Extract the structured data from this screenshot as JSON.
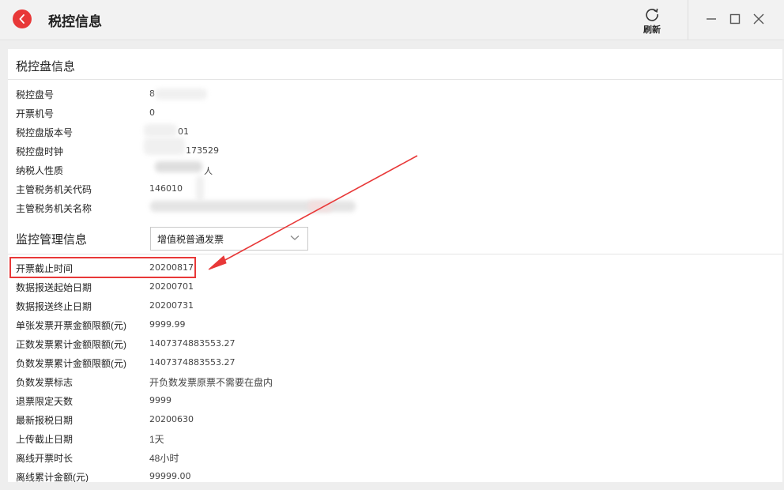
{
  "window": {
    "title": "税控信息",
    "refresh_label": "刷新"
  },
  "section1": {
    "title": "税控盘信息",
    "rows": [
      {
        "label": "税控盘号",
        "value": "8"
      },
      {
        "label": "开票机号",
        "value": "0"
      },
      {
        "label": "税控盘版本号",
        "value": "01"
      },
      {
        "label": "税控盘时钟",
        "value": "173529"
      },
      {
        "label": "纳税人性质",
        "value": "人"
      },
      {
        "label": "主管税务机关代码",
        "value": "146010"
      },
      {
        "label": "主管税务机关名称",
        "value": ""
      }
    ]
  },
  "section2": {
    "title": "监控管理信息",
    "invoice_type_selected": "增值税普通发票",
    "rows": [
      {
        "label": "开票截止时间",
        "value": "20200817"
      },
      {
        "label": "数据报送起始日期",
        "value": "20200701"
      },
      {
        "label": "数据报送终止日期",
        "value": "20200731"
      },
      {
        "label": "单张发票开票金额限额(元)",
        "value": "9999.99"
      },
      {
        "label": "正数发票累计金额限额(元)",
        "value": "1407374883553.27"
      },
      {
        "label": "负数发票累计金额限额(元)",
        "value": "1407374883553.27"
      },
      {
        "label": "负数发票标志",
        "value": "开负数发票原票不需要在盘内"
      },
      {
        "label": "退票限定天数",
        "value": "9999"
      },
      {
        "label": "最新报税日期",
        "value": "20200630"
      },
      {
        "label": "上传截止日期",
        "value": "1天"
      },
      {
        "label": "离线开票时长",
        "value": "48小时"
      },
      {
        "label": "离线累计金额(元)",
        "value": "99999.00"
      }
    ]
  },
  "colors": {
    "accent": "#e83838",
    "background": "#eeeeee",
    "panel": "#ffffff"
  },
  "icons": [
    "back-arrow-icon",
    "refresh-icon",
    "minimize-icon",
    "maximize-icon",
    "close-icon",
    "chevron-down-icon"
  ]
}
